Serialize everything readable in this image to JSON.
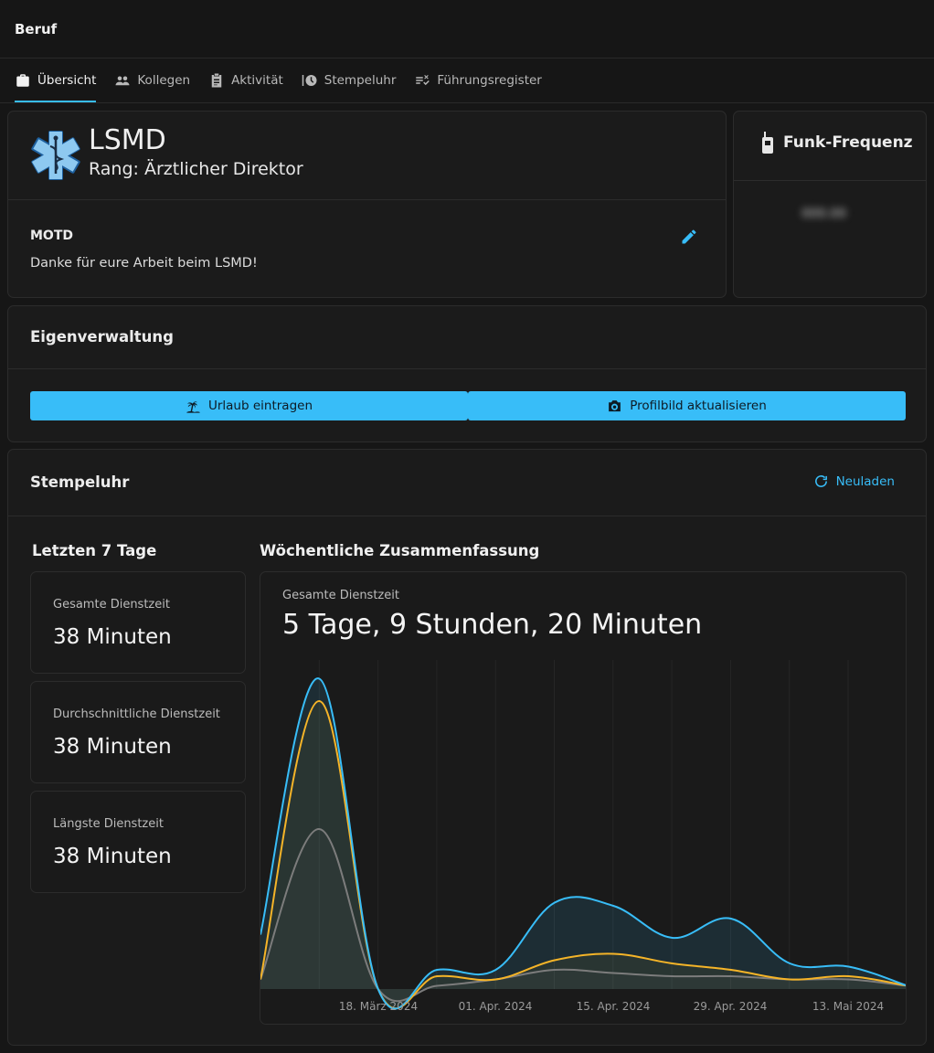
{
  "header": {
    "title": "Beruf"
  },
  "tabs": [
    {
      "label": "Übersicht",
      "icon": "briefcase-icon",
      "active": true
    },
    {
      "label": "Kollegen",
      "icon": "users-icon"
    },
    {
      "label": "Aktivität",
      "icon": "clipboard-icon"
    },
    {
      "label": "Stempeluhr",
      "icon": "timeclock-icon"
    },
    {
      "label": "Führungsregister",
      "icon": "checklist-icon"
    }
  ],
  "org": {
    "name": "LSMD",
    "rank": "Rang: Ärztlicher Direktor",
    "motd_label": "MOTD",
    "motd_text": "Danke für eure Arbeit beim LSMD!"
  },
  "radio": {
    "title": "Funk-Frequenz",
    "value": "000.00"
  },
  "self_service": {
    "title": "Eigenverwaltung",
    "vacation_label": "Urlaub eintragen",
    "profile_pic_label": "Profilbild aktualisieren"
  },
  "timeclock": {
    "title": "Stempeluhr",
    "reload_label": "Neuladen",
    "last7_heading": "Letzten 7 Tage",
    "weekly_heading": "Wöchentliche Zusammenfassung",
    "stats": [
      {
        "label": "Gesamte Dienstzeit",
        "value": "38 Minuten"
      },
      {
        "label": "Durchschnittliche Dienstzeit",
        "value": "38 Minuten"
      },
      {
        "label": "Längste Dienstzeit",
        "value": "38 Minuten"
      }
    ],
    "summary_label": "Gesamte Dienstzeit",
    "summary_value": "5 Tage, 9 Stunden, 20 Minuten"
  },
  "colors": {
    "accent": "#38bdf8",
    "series2": "#f5b428",
    "series3": "#7c7c7c"
  },
  "chart_data": {
    "type": "area",
    "x_ticks": [
      "18. März 2024",
      "01. Apr. 2024",
      "15. Apr. 2024",
      "29. Apr. 2024",
      "13. Mai 2024"
    ],
    "series": [
      {
        "values": [
          0.17,
          0.97,
          0.0,
          0.06,
          0.06,
          0.27,
          0.26,
          0.16,
          0.22,
          0.08,
          0.07,
          0.01
        ],
        "color": "#38bdf8"
      },
      {
        "values": [
          0.03,
          0.9,
          0.0,
          0.04,
          0.03,
          0.09,
          0.11,
          0.08,
          0.06,
          0.03,
          0.04,
          0.01
        ],
        "color": "#f5b428"
      },
      {
        "values": [
          0.03,
          0.5,
          0.0,
          0.01,
          0.03,
          0.06,
          0.05,
          0.04,
          0.04,
          0.03,
          0.03,
          0.01
        ],
        "color": "#7c7c7c"
      }
    ]
  }
}
